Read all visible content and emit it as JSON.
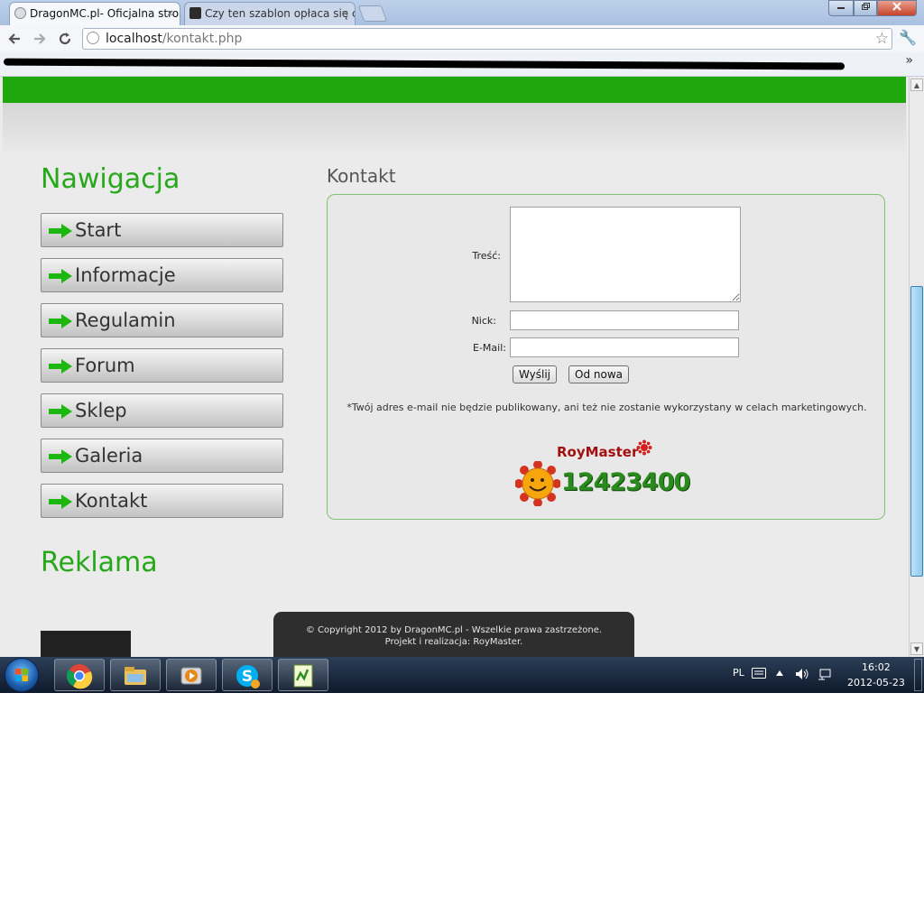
{
  "browser": {
    "tabs": [
      {
        "title": "DragonMC.pl- Oficjalna stro",
        "active": true
      },
      {
        "title": "Czy ten szablon opłaca się c",
        "active": false
      }
    ],
    "close_glyph": "×",
    "url_host": "localhost",
    "url_path": "/kontakt.php",
    "bookmarks_overflow": "»"
  },
  "sidebar": {
    "nav_heading": "Nawigacja",
    "items": [
      {
        "label": "Start"
      },
      {
        "label": "Informacje"
      },
      {
        "label": "Regulamin"
      },
      {
        "label": "Forum"
      },
      {
        "label": "Sklep"
      },
      {
        "label": "Galeria"
      },
      {
        "label": "Kontakt"
      }
    ],
    "ads_heading": "Reklama"
  },
  "contact": {
    "title": "Kontakt",
    "labels": {
      "message": "Treść:",
      "nick": "Nick:",
      "email": "E-Mail:"
    },
    "values": {
      "message": "",
      "nick": "",
      "email": ""
    },
    "submit_label": "Wyślij",
    "reset_label": "Od nowa",
    "notice": "*Twój adres e-mail nie będzie publikowany, ani też nie zostanie wykorzystany w celach marketingowych.",
    "gg": {
      "name": "RoyMaster",
      "number": "12423400"
    }
  },
  "footer": {
    "line1": "© Copyright 2012 by DragonMC.pl - Wszelkie prawa zastrzeżone.",
    "line2": "Projekt i realizacja: RoyMaster."
  },
  "taskbar": {
    "language": "PL",
    "time": "16:02",
    "date": "2012-05-23",
    "apps": [
      "chrome-icon",
      "explorer-icon",
      "media-player-icon",
      "skype-icon",
      "notepad-plus-icon"
    ]
  },
  "colors": {
    "brand_green": "#1fa80e",
    "heading_green": "#27a81a",
    "form_border": "#7fc46f",
    "gg_number": "#2b8a1d"
  }
}
